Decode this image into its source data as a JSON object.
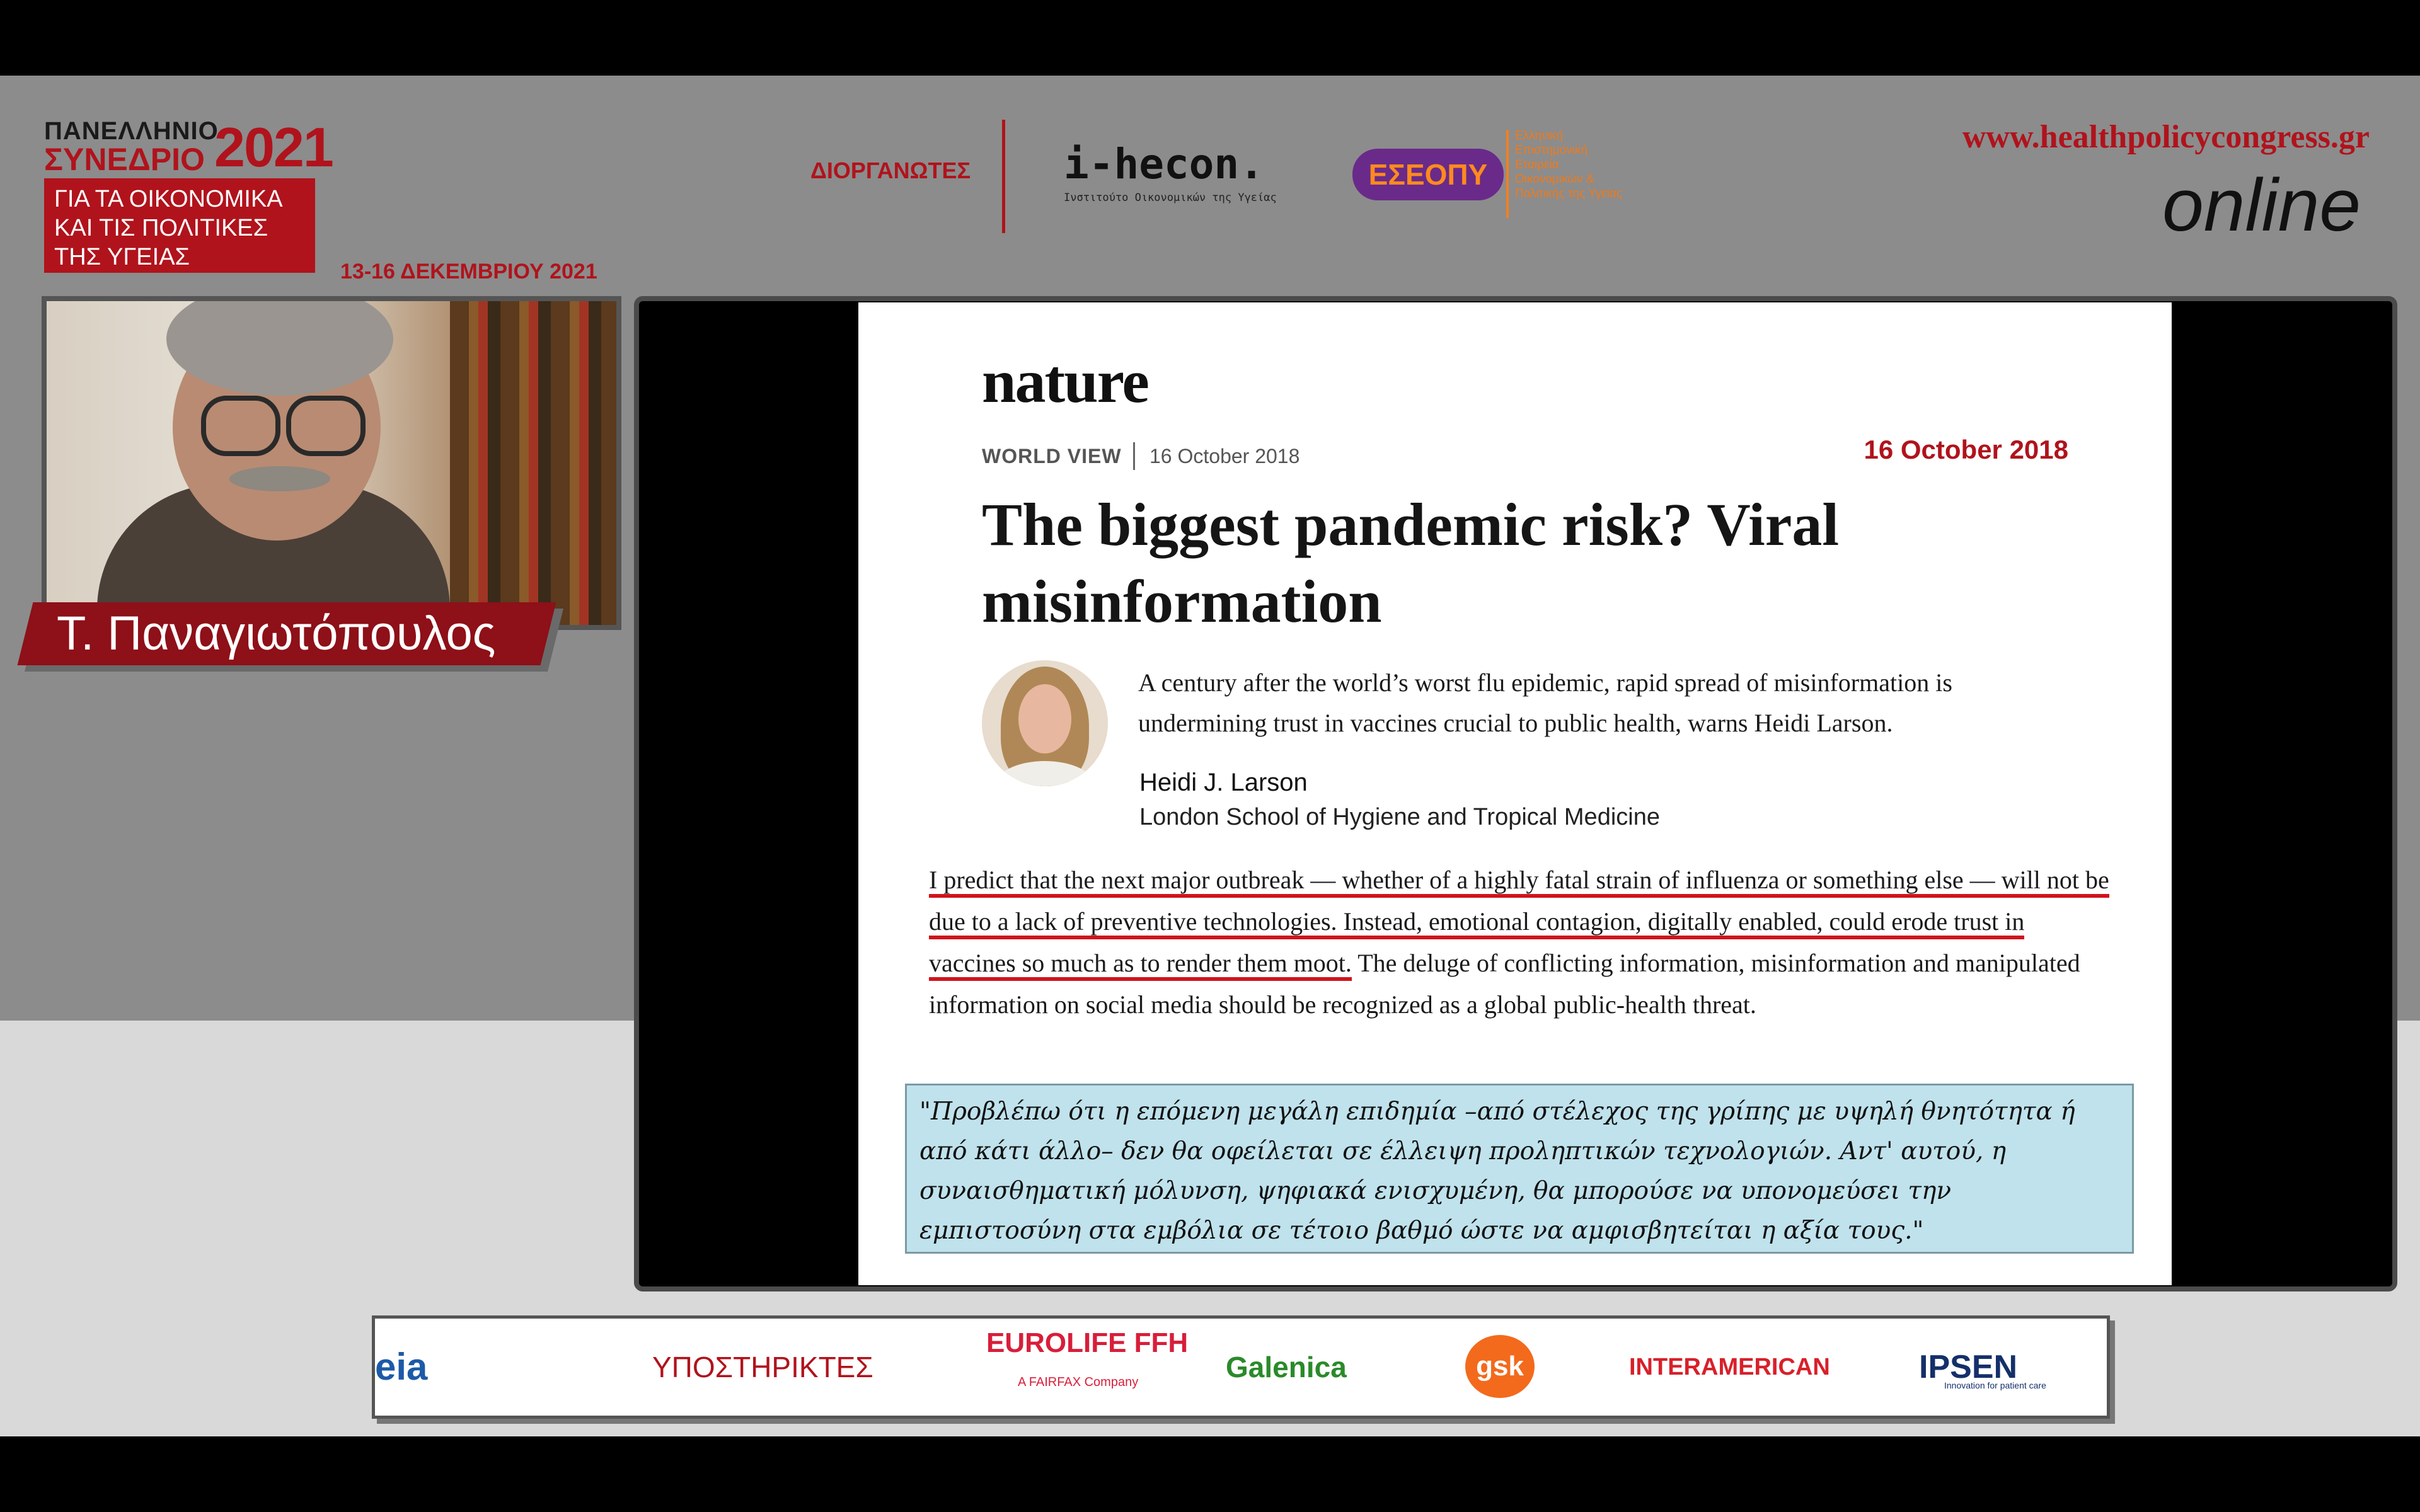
{
  "header": {
    "congress_line1": "ΠΑΝΕΛΛΗΝΙΟ",
    "congress_line2": "ΣΥΝΕΔΡΙΟ",
    "congress_year": "2021",
    "congress_box_line1": "ΓΙΑ ΤΑ ΟΙΚΟΝΟΜΙΚΑ",
    "congress_box_line2": "ΚΑΙ ΤΙΣ ΠΟΛΙΤΙΚΕΣ",
    "congress_box_line3": "ΤΗΣ ΥΓΕΙΑΣ",
    "congress_dates": "13-16 ΔΕΚΕΜΒΡΙΟΥ 2021",
    "organizers_label": "ΔΙΟΡΓΑΝΩΤΕΣ",
    "ihecon_wordmark": "i-hecon.",
    "ihecon_subtitle": "Ινστιτούτο Οικονομικών της Υγείας",
    "eseopu_wordmark": "ΕΣΕΟΠΥ",
    "eseopu_text": "Ελληνική Επιστημονική Εταιρεία Οικονομικών & Πολιτικής της Υγείας",
    "site_url": "www.healthpolicycongress.gr",
    "online_label": "online"
  },
  "speaker": {
    "name": "Τ. Παναγιωτόπουλος"
  },
  "slide": {
    "journal_logo": "nature",
    "section_label": "WORLD VIEW",
    "section_date": "16 October 2018",
    "date_highlight": "16 October 2018",
    "title": "The biggest pandemic risk? Viral misinformation",
    "standfirst": "A century after the world’s worst flu epidemic, rapid spread of misinformation is undermining trust in vaccines crucial to public health, warns Heidi Larson.",
    "author_name": "Heidi J. Larson",
    "author_affiliation": "London School of Hygiene and Tropical Medicine",
    "body_highlighted": "I predict that the next major outbreak — whether of a highly fatal strain of influenza or something else — will not be due to a lack of preventive technologies. Instead, emotional contagion, digitally enabled, could erode trust in vaccines so much as to render them moot.",
    "body_rest": " The deluge of conflicting information, misinformation and manipulated information on social media should be recognized as a global public-health threat.",
    "translation": "\"Προβλέπω ότι η επόμενη μεγάλη επιδημία –από στέλεχος της γρίπης με υψηλή θνητότητα ή από κάτι άλλο– δεν θα οφείλεται σε έλλειψη προληπτικών τεχνολογιών. Αντ' αυτού, η συναισθηματική μόλυνση, ψηφιακά ενισχυμένη, θα μπορούσε να υπονομεύσει την εμπιστοσύνη στα εμβόλια σε τέτοιο βαθμό ώστε να αμφισβητείται η αξία τους.\""
  },
  "sponsors": {
    "partial_logo": "eia",
    "label": "ΥΠΟΣΤΗΡΙΚΤΕΣ",
    "eurolife": "EUROLIFE FFH",
    "eurolife_sub": "A FAIRFAX Company",
    "galenica": "Galenica",
    "gsk": "gsk",
    "interamerican": "INTERAMERICAN",
    "ipsen": "IPSEN",
    "ipsen_sub": "Innovation for patient care"
  },
  "colors": {
    "brand_red": "#b0131c",
    "translation_bg": "#bfe2ec",
    "stage_gray": "#8c8c8c"
  }
}
